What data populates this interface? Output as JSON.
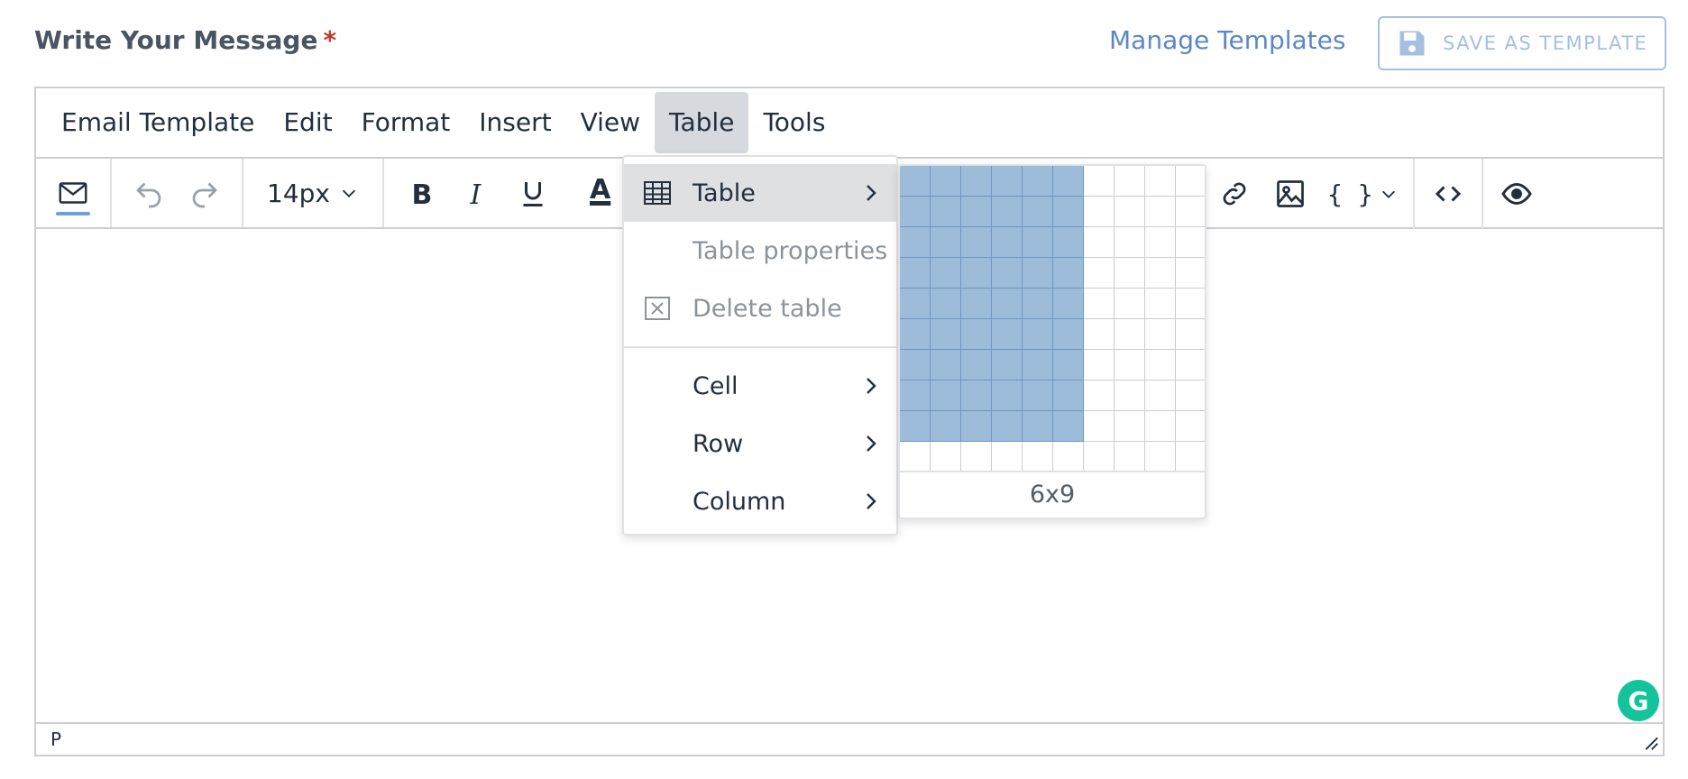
{
  "header": {
    "title": "Write Your Message",
    "required_mark": "*",
    "manage_templates": "Manage Templates",
    "save_as_template": "SAVE AS TEMPLATE"
  },
  "menubar": {
    "items": [
      "Email Template",
      "Edit",
      "Format",
      "Insert",
      "View",
      "Table",
      "Tools"
    ],
    "active": "Table"
  },
  "toolbar": {
    "font_size": "14px"
  },
  "dropdown": {
    "items": [
      {
        "label": "Table",
        "icon": "table-icon",
        "submenu": true,
        "active": true
      },
      {
        "label": "Table properties",
        "icon": "",
        "disabled": true
      },
      {
        "label": "Delete table",
        "icon": "delete-table-icon",
        "disabled": true
      },
      {
        "label": "Cell",
        "submenu": true
      },
      {
        "label": "Row",
        "submenu": true
      },
      {
        "label": "Column",
        "submenu": true
      }
    ]
  },
  "grid_picker": {
    "columns": 10,
    "rows": 10,
    "selected_cols": 6,
    "selected_rows": 9,
    "label": "6x9"
  },
  "statusbar": {
    "element_path": "P"
  },
  "colors": {
    "accent": "#5b87c4",
    "selection": "#9dbcda",
    "required": "#c0392b",
    "grammarly": "#15c39a"
  }
}
